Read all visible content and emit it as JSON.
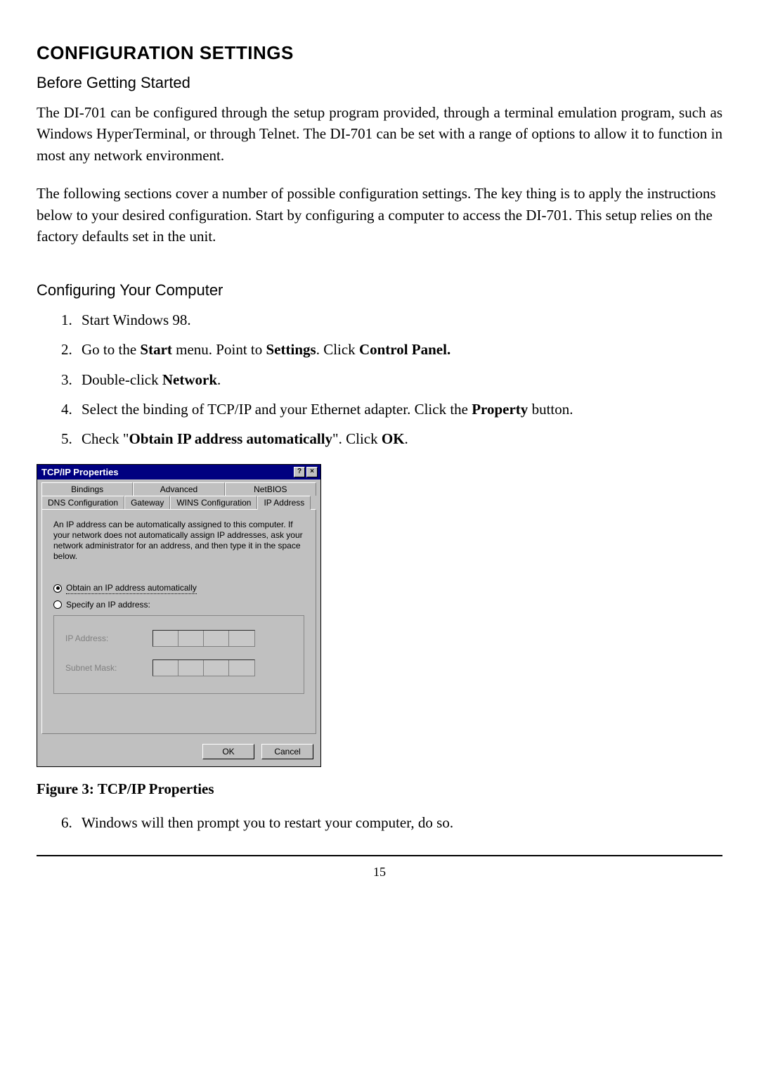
{
  "heading": "CONFIGURATION SETTINGS",
  "subheading1": "Before Getting Started",
  "para1": "The DI-701 can be configured through the setup program provided, through a terminal emulation program, such as Windows HyperTerminal, or through Telnet.  The DI-701 can be set with a range of options to allow it to function in most any network environment.",
  "para2": "The following sections cover a number of possible configuration settings.  The key thing is to apply the instructions below to your desired configuration.  Start by configuring a computer to access the DI-701.  This setup relies on the factory defaults set in the unit.",
  "subheading2": "Configuring Your Computer",
  "step1": "Start Windows 98.",
  "step2_a": "Go to the ",
  "step2_b": "Start",
  "step2_c": " menu. Point to ",
  "step2_d": "Settings",
  "step2_e": ". Click ",
  "step2_f": "Control Panel.",
  "step3_a": "Double-click ",
  "step3_b": "Network",
  "step3_c": ".",
  "step4_a": "Select the binding of TCP/IP and your Ethernet adapter. Click the ",
  "step4_b": "Property",
  "step4_c": " button.",
  "step5_a": "Check \"",
  "step5_b": "Obtain IP address automatically",
  "step5_c": "\". Click ",
  "step5_d": "OK",
  "step5_e": ".",
  "figure_caption": "Figure 3: TCP/IP Properties",
  "step6": "Windows will then prompt you to restart your computer, do so.",
  "page_number": "15",
  "dialog": {
    "title": "TCP/IP Properties",
    "help_glyph": "?",
    "close_glyph": "×",
    "tabs_row1": {
      "t0": "Bindings",
      "t1": "Advanced",
      "t2": "NetBIOS"
    },
    "tabs_row2": {
      "t0": "DNS Configuration",
      "t1": "Gateway",
      "t2": "WINS Configuration",
      "t3": "IP Address"
    },
    "description": "An IP address can be automatically assigned to this computer. If your network does not automatically assign IP addresses, ask your network administrator for an address, and then type it in the space below.",
    "radio_auto": "Obtain an IP address automatically",
    "radio_specify": "Specify an IP address:",
    "label_ip": "IP Address:",
    "label_mask": "Subnet Mask:",
    "ok": "OK",
    "cancel": "Cancel"
  }
}
